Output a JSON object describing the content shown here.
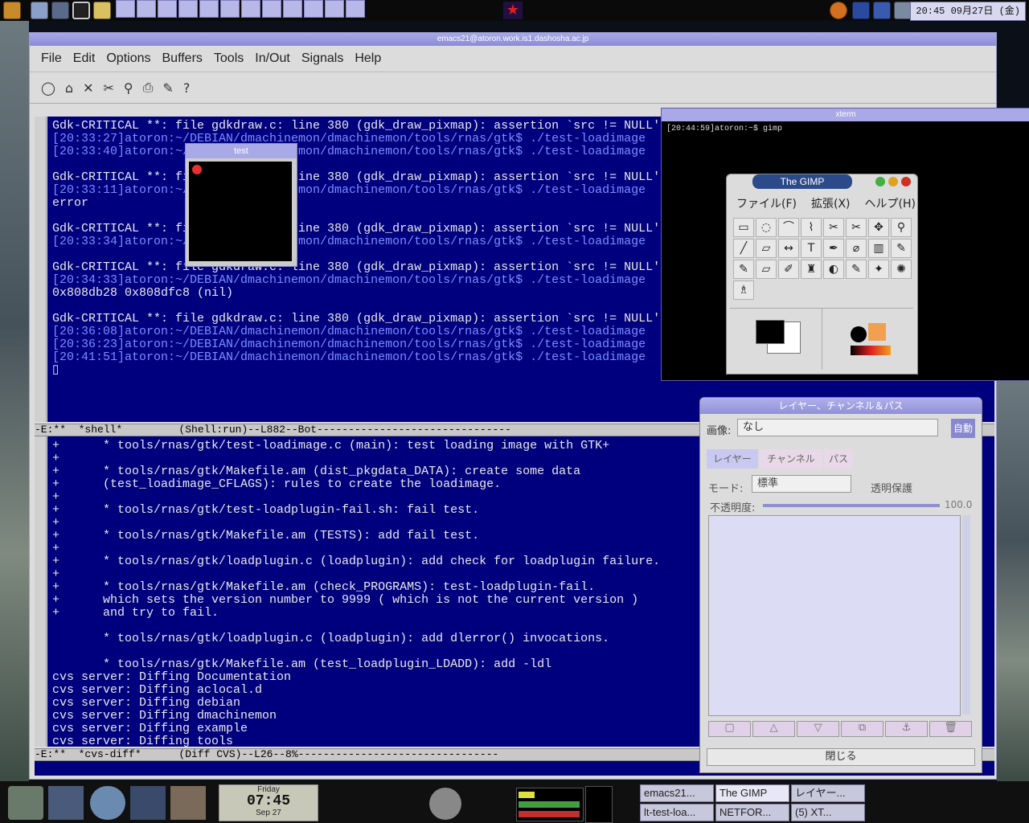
{
  "top_panel": {
    "clock": "20:45 09月27日 (金)",
    "icons": [
      "foot-menu-icon",
      "toolbox-icon",
      "terminal-icon",
      "monitor-icon",
      "star-icon",
      "disk-icon",
      "sun-icon",
      "wrench-icon",
      "browser-icon"
    ]
  },
  "emacs": {
    "title": "emacs21@atoron.work.is1.dashosha.ac.jp",
    "menu": [
      "File",
      "Edit",
      "Options",
      "Buffers",
      "Tools",
      "In/Out",
      "Signals",
      "Help"
    ],
    "toolbar_icons": [
      "new-file-icon",
      "open-folder-icon",
      "close-icon",
      "cut-icon",
      "search-icon",
      "print-icon",
      "spell-icon",
      "help-icon"
    ],
    "shell_lines": [
      {
        "t": "Gdk-CRITICAL **: file gdkdraw.c: line 380 (gdk_draw_pixmap): assertion `src != NULL' failed.",
        "c": "w"
      },
      {
        "t": "[20:33:27]atoron:~/DEBIAN/dmachinemon/dmachinemon/tools/rnas/gtk$ ./test-loadimage",
        "c": "p"
      },
      {
        "t": "[20:33:40]atoron:~/DEBIAN/dmachinemon/dmachinemon/tools/rnas/gtk$ ./test-loadimage",
        "c": "p"
      },
      {
        "t": "",
        "c": "w"
      },
      {
        "t": "Gdk-CRITICAL **: file gdkdraw.c: line 380 (gdk_draw_pixmap): assertion `src != NULL' failed.",
        "c": "w"
      },
      {
        "t": "[20:33:11]atoron:~/DEBIAN/dmachinemon/dmachinemon/tools/rnas/gtk$ ./test-loadimage",
        "c": "p"
      },
      {
        "t": "error",
        "c": "w"
      },
      {
        "t": "",
        "c": "w"
      },
      {
        "t": "Gdk-CRITICAL **: file gdkdraw.c: line 380 (gdk_draw_pixmap): assertion `src != NULL' failed.",
        "c": "w"
      },
      {
        "t": "[20:33:34]atoron:~/DEBIAN/dmachinemon/dmachinemon/tools/rnas/gtk$ ./test-loadimage",
        "c": "p"
      },
      {
        "t": "",
        "c": "w"
      },
      {
        "t": "Gdk-CRITICAL **: file gdkdraw.c: line 380 (gdk_draw_pixmap): assertion `src != NULL' failed.",
        "c": "w"
      },
      {
        "t": "[20:34:33]atoron:~/DEBIAN/dmachinemon/dmachinemon/tools/rnas/gtk$ ./test-loadimage",
        "c": "p"
      },
      {
        "t": "0x808db28 0x808dfc8 (nil)",
        "c": "w"
      },
      {
        "t": "",
        "c": "w"
      },
      {
        "t": "Gdk-CRITICAL **: file gdkdraw.c: line 380 (gdk_draw_pixmap): assertion `src != NULL' failed.",
        "c": "w"
      },
      {
        "t": "[20:36:08]atoron:~/DEBIAN/dmachinemon/dmachinemon/tools/rnas/gtk$ ./test-loadimage",
        "c": "p"
      },
      {
        "t": "[20:36:23]atoron:~/DEBIAN/dmachinemon/dmachinemon/tools/rnas/gtk$ ./test-loadimage",
        "c": "p"
      },
      {
        "t": "[20:41:51]atoron:~/DEBIAN/dmachinemon/dmachinemon/tools/rnas/gtk$ ./test-loadimage",
        "c": "p"
      },
      {
        "t": "▯",
        "c": "w"
      }
    ],
    "modeline1": "-E:**  *shell*         (Shell:run)--L882--Bot-------------------------------",
    "diff_lines": [
      "+      * tools/rnas/gtk/test-loadimage.c (main): test loading image with GTK+",
      "+",
      "+      * tools/rnas/gtk/Makefile.am (dist_pkgdata_DATA): create some data",
      "+      (test_loadimage_CFLAGS): rules to create the loadimage.",
      "+",
      "+      * tools/rnas/gtk/test-loadplugin-fail.sh: fail test.",
      "+",
      "+      * tools/rnas/gtk/Makefile.am (TESTS): add fail test.",
      "+",
      "+      * tools/rnas/gtk/loadplugin.c (loadplugin): add check for loadplugin failure.",
      "+",
      "+      * tools/rnas/gtk/Makefile.am (check_PROGRAMS): test-loadplugin-fail.",
      "+      which sets the version number to 9999 ( which is not the current version )",
      "+      and try to fail.",
      "",
      "       * tools/rnas/gtk/loadplugin.c (loadplugin): add dlerror() invocations.",
      "",
      "       * tools/rnas/gtk/Makefile.am (test_loadplugin_LDADD): add -ldl",
      "cvs server: Diffing Documentation",
      "cvs server: Diffing aclocal.d",
      "cvs server: Diffing debian",
      "cvs server: Diffing dmachinemon",
      "cvs server: Diffing example",
      "cvs server: Diffing tools"
    ],
    "modeline2": "-E:**  *cvs-diff*      (Diff CVS)--L26--8%--------------------------------"
  },
  "test_window": {
    "title": "test"
  },
  "xterm": {
    "title": "xterm",
    "prompt": "[20:44:59]atoron:~$ gimp"
  },
  "gimp": {
    "title": "The GIMP",
    "menu": [
      "ファイル(F)",
      "拡張(X)",
      "ヘルプ(H)"
    ],
    "tools": [
      "▭",
      "◌",
      "⌒",
      "⌇",
      "✂",
      "✂",
      "✥",
      "⚲",
      "╱",
      "▱",
      "↔",
      "T",
      "✒",
      "⌀",
      "▥",
      "✎",
      "✎",
      "▱",
      "✐",
      "♜",
      "◐",
      "✎",
      "✦",
      "✺",
      "♗"
    ],
    "fg_color": "#000000",
    "bg_color": "#ffffff"
  },
  "layers": {
    "title": "レイヤー、チャンネル＆パス",
    "image_label": "画像:",
    "image_value": "なし",
    "auto_button": "自動",
    "tabs": [
      "レイヤー",
      "チャンネル",
      "パス"
    ],
    "mode_label": "モード:",
    "mode_value": "標準",
    "preserve_label": "透明保護",
    "opacity_label": "不透明度:",
    "opacity_value": "100.0",
    "close_button": "閉じる"
  },
  "bottom_panel": {
    "clock_day": "Friday",
    "clock_time": "07:45",
    "clock_date": "Sep 27",
    "tasks": [
      "emacs21...",
      "The GIMP",
      "レイヤー...",
      "lt-test-loa...",
      "NETFOR...",
      "(5) XT..."
    ]
  }
}
